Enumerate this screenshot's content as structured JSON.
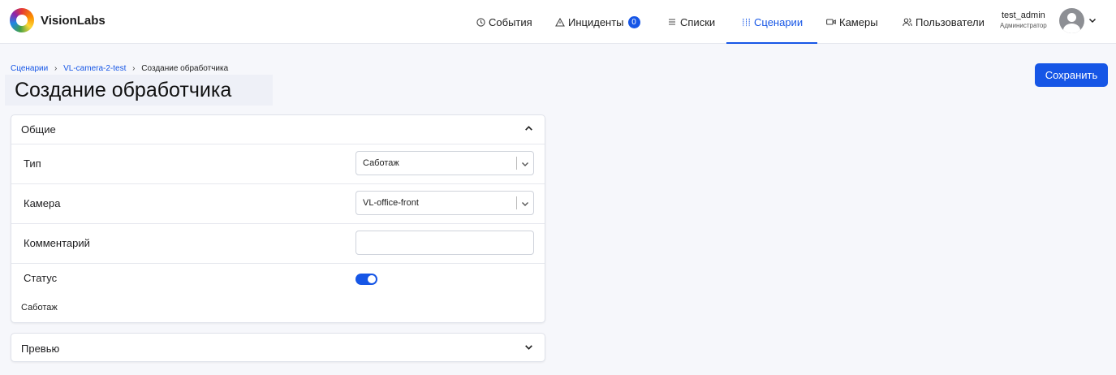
{
  "brand": {
    "name": "VisionLabs"
  },
  "nav": {
    "events": {
      "label": "События",
      "icon": "clock-icon"
    },
    "incidents": {
      "label": "Инциденты",
      "icon": "warning-triangle-icon",
      "badge": "0"
    },
    "lists": {
      "label": "Списки",
      "icon": "list-icon"
    },
    "scenarios": {
      "label": "Сценарии",
      "icon": "sliders-icon",
      "active": true
    },
    "cameras": {
      "label": "Камеры",
      "icon": "video-camera-icon"
    },
    "users": {
      "label": "Пользователи",
      "icon": "users-icon"
    }
  },
  "user": {
    "name": "test_admin",
    "role": "Администратор"
  },
  "breadcrumb": {
    "items": [
      "Сценарии",
      "VL-camera-2-test",
      "Создание обработчика"
    ],
    "separator": "›"
  },
  "page": {
    "title": "Создание обработчика",
    "save_label": "Сохранить"
  },
  "general": {
    "title": "Общие",
    "type": {
      "label": "Тип",
      "value": "Саботаж"
    },
    "camera": {
      "label": "Камера",
      "value": "VL-office-front"
    },
    "comment": {
      "label": "Комментарий",
      "value": ""
    },
    "status": {
      "label": "Статус",
      "enabled": true,
      "note": "Саботаж"
    }
  },
  "preview": {
    "title": "Превью"
  },
  "colors": {
    "accent": "#1656e6",
    "background": "#f6f7fb"
  }
}
